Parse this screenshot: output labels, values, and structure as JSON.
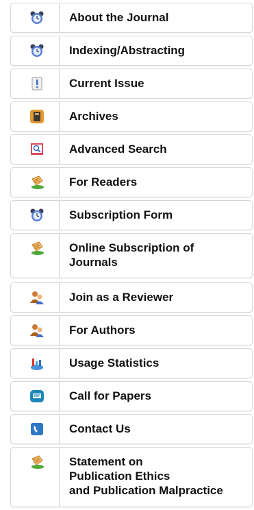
{
  "menu": {
    "items": [
      {
        "label": "About the Journal",
        "icon": "alarm-clock-icon"
      },
      {
        "label": "Indexing/Abstracting",
        "icon": "alarm-clock-icon"
      },
      {
        "label": "Current Issue",
        "icon": "document-exclamation-icon"
      },
      {
        "label": "Archives",
        "icon": "archive-book-icon"
      },
      {
        "label": "Advanced Search",
        "icon": "search-book-icon"
      },
      {
        "label": "For Readers",
        "icon": "reader-hand-icon"
      },
      {
        "label": "Subscription Form",
        "icon": "alarm-clock-icon"
      },
      {
        "label": "Online Subscription of\nJournals",
        "icon": "reader-hand-icon"
      },
      {
        "label": "Join as a Reviewer",
        "icon": "users-icon"
      },
      {
        "label": "For Authors",
        "icon": "users-icon"
      },
      {
        "label": "Usage Statistics",
        "icon": "statistics-chart-icon"
      },
      {
        "label": "Call for Papers",
        "icon": "papers-card-icon"
      },
      {
        "label": "Contact Us",
        "icon": "phone-icon"
      },
      {
        "label": "Statement on\nPublication Ethics\nand Publication Malpractice",
        "icon": "reader-hand-icon"
      }
    ]
  }
}
